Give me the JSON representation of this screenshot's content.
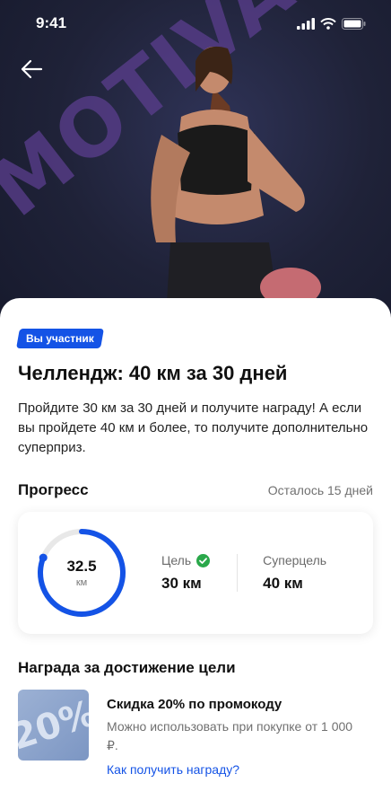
{
  "status_bar": {
    "time": "9:41"
  },
  "hero": {
    "background_text": "MOTIVATION"
  },
  "badge": {
    "label": "Вы участник"
  },
  "challenge": {
    "title": "Челлендж: 40 км за 30 дней",
    "description": "Пройдите 30 км за 30 дней и получите награду! А если вы пройдете 40 км и более, то получите дополнительно суперприз."
  },
  "progress": {
    "title": "Прогресс",
    "remaining": "Осталось 15 дней",
    "value": "32.5",
    "unit": "км",
    "fraction": 0.81,
    "goal_label": "Цель",
    "goal_value": "30 км",
    "super_label": "Суперцель",
    "super_value": "40 км"
  },
  "reward": {
    "section_title": "Награда за достижение цели",
    "image_text": "20%",
    "name": "Скидка 20% по промокоду",
    "description": "Можно использовать при покупке от 1 000 ₽.",
    "link": "Как получить награду?"
  },
  "colors": {
    "accent": "#1453e6",
    "success": "#2aa84a",
    "ring_track": "#e8e8e8",
    "hero_bg": "#1f2238"
  },
  "icons": {
    "back": "arrow-left-icon",
    "check": "check-circle-icon",
    "signal": "signal-icon",
    "wifi": "wifi-icon",
    "battery": "battery-icon"
  }
}
